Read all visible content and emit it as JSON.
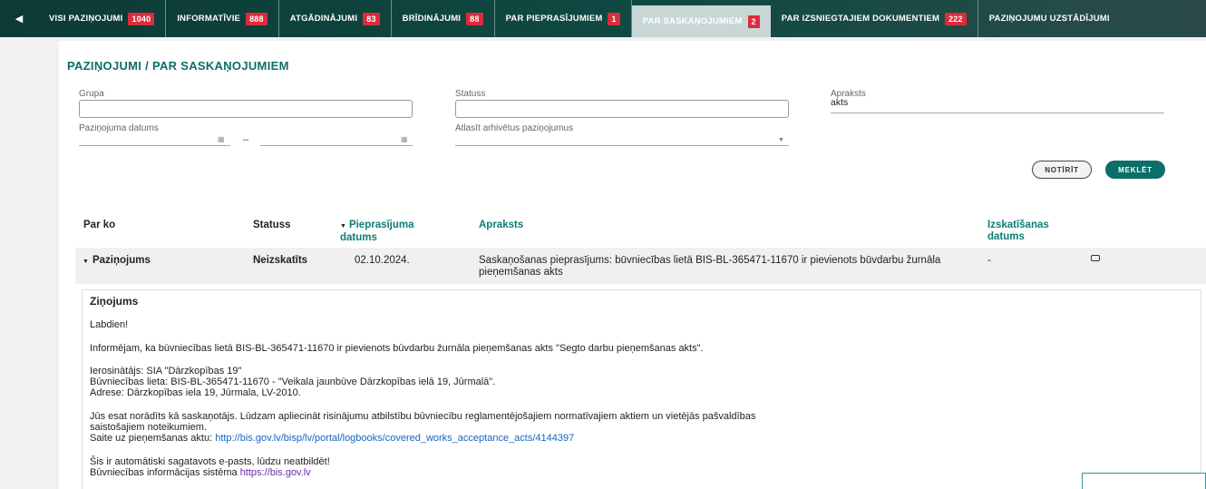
{
  "nav": {
    "back_icon": "chevron-left-icon",
    "tabs": [
      {
        "label": "VISI PAZIŅOJUMI",
        "count": "1040"
      },
      {
        "label": "INFORMATĪVIE",
        "count": "888"
      },
      {
        "label": "ATGĀDINĀJUMI",
        "count": "83"
      },
      {
        "label": "BRĪDINĀJUMI",
        "count": "88"
      },
      {
        "label": "PAR PIEPRASĪJUMIEM",
        "count": "1"
      },
      {
        "label": "PAR SASKAŅOJUMIEM",
        "count": "2"
      },
      {
        "label": "PAR IZSNIEGTAJIEM DOKUMENTIEM",
        "count": "222"
      },
      {
        "label": "PAZIŅOJUMU UZSTĀDĪJUMI"
      }
    ],
    "active_index": 5
  },
  "page": {
    "title": "PAZIŅOJUMI / PAR SASKAŅOJUMIEM"
  },
  "filters": {
    "grupa": {
      "label": "Grupa",
      "value": ""
    },
    "statuss": {
      "label": "Statuss",
      "value": ""
    },
    "apraksts": {
      "label": "Apraksts",
      "value": "akts"
    },
    "datums": {
      "label": "Paziņojuma datums",
      "from": "",
      "to": "",
      "separator": "–"
    },
    "arhivs": {
      "label": "Atlasīt arhivētus paziņojumus",
      "value": ""
    },
    "clear_label": "NOTĪRĪT",
    "search_label": "MEKLĒT"
  },
  "table": {
    "headers": {
      "par_ko": "Par ko",
      "statuss": "Statuss",
      "datums": "Pieprasījuma datums",
      "apraksts": "Apraksts",
      "izskatisanas": "Izskatīšanas datums"
    },
    "row": {
      "par_ko": "Paziņojums",
      "statuss": "Neizskatīts",
      "datums": "02.10.2024.",
      "apraksts": "Saskaņošanas pieprasījums: būvniecības lietā BIS-BL-365471-11670 ir pievienots būvdarbu žurnāla pieņemšanas akts",
      "izskatisanas": "-"
    }
  },
  "message": {
    "title": "Ziņojums",
    "greeting": "Labdien!",
    "p1": "Informējam, ka būvniecības lietā BIS-BL-365471-11670 ir pievienots būvdarbu žurnāla pieņemšanas akts \"Segto darbu pieņemšanas akts\".",
    "ierosinatajs": "Ierosinātājs: SIA \"Dārzkopības 19\"",
    "lieta": "Būvniecības lieta: BIS-BL-365471-11670 - \"Veikala jaunbūve Dārzkopības ielā 19, Jūrmalā\".",
    "adrese": "Adrese: Dārzkopības iela 19, Jūrmala, LV-2010.",
    "p3a": "Jūs esat norādīts kā saskaņotājs. Lūdzam apliecināt risinājumu atbilstību būvniecību reglamentējošajiem normatīvajiem aktiem un vietējās pašvaldības",
    "p3b": "saistošajiem noteikumiem.",
    "saite_label": "Saite uz pieņemšanas aktu:",
    "saite_url": "http://bis.gov.lv/bisp/lv/portal/logbooks/covered_works_acceptance_acts/4144397",
    "auto": "Šis ir automātiski sagatavots e-pasts, lūdzu neatbildēt!",
    "sistema_label": "Būvniecības informācijas sistēma",
    "sistema_url": "https://bis.gov.lv"
  }
}
